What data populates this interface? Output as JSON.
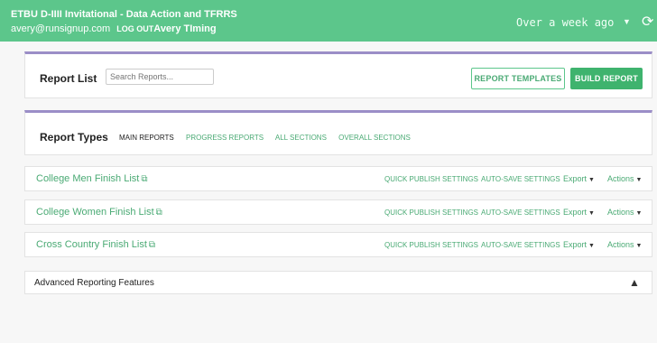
{
  "header": {
    "title": "ETBU D-IIII Invitational - Data Action and TFRRS",
    "email": "avery@runsignup.com",
    "logout": "LOG OUT",
    "org": "Avery TIming",
    "range": "Over a week ago",
    "caret_icon": "▼",
    "refresh_icon": "⟳"
  },
  "report_list": {
    "title": "Report List",
    "search_placeholder": "Search Reports...",
    "templates_label": "REPORT TEMPLATES",
    "build_label": "BUILD REPORT"
  },
  "report_types": {
    "title": "Report Types",
    "tabs": [
      "MAIN REPORTS",
      "PROGRESS REPORTS",
      "ALL SECTIONS",
      "OVERALL SECTIONS"
    ]
  },
  "reports": [
    {
      "name": "College Men Finish List",
      "quick": "QUICK PUBLISH SETTINGS",
      "autosave": "AUTO-SAVE SETTINGS",
      "export": "Export",
      "actions": "Actions"
    },
    {
      "name": "College Women Finish List",
      "quick": "QUICK PUBLISH SETTINGS",
      "autosave": "AUTO-SAVE SETTINGS",
      "export": "Export",
      "actions": "Actions"
    },
    {
      "name": "Cross Country Finish List",
      "quick": "QUICK PUBLISH SETTINGS",
      "autosave": "AUTO-SAVE SETTINGS",
      "export": "Export",
      "actions": "Actions"
    }
  ],
  "icons": {
    "copy": "⧉",
    "dropdown": "▼",
    "collapse": "▲"
  },
  "advanced": {
    "label": "Advanced Reporting Features"
  },
  "colors": {
    "green": "#5cc68b",
    "link_green": "#4aaa74",
    "purple_accent": "#9b8ec7"
  }
}
